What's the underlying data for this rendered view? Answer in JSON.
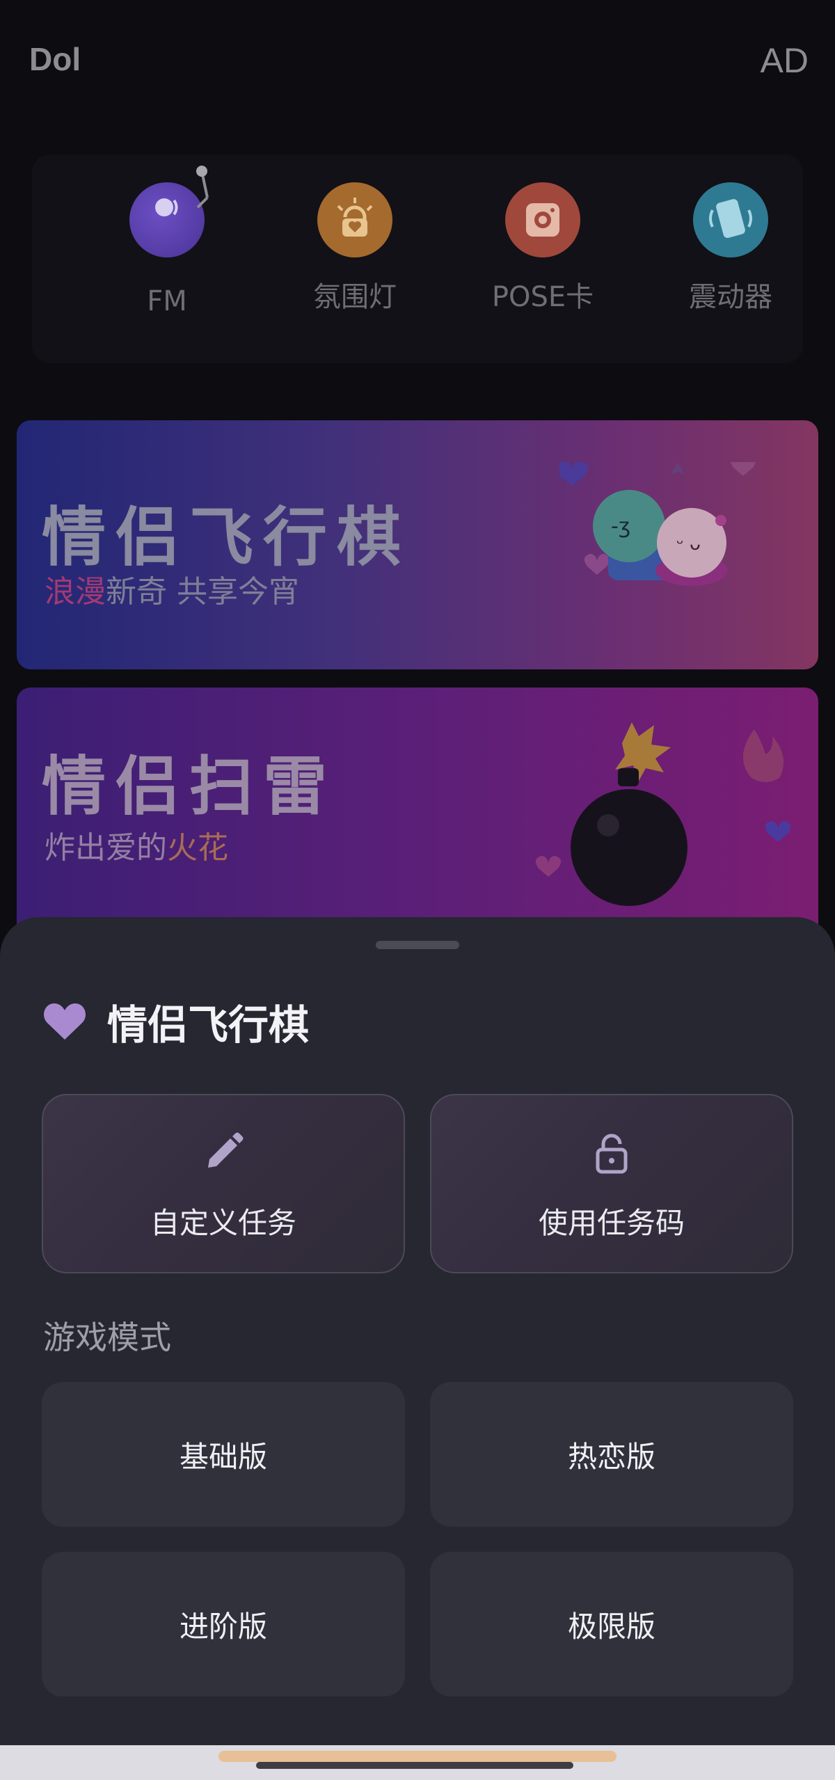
{
  "header": {
    "logo": "Dol",
    "ad_label": "AD"
  },
  "tools": [
    {
      "label": "FM",
      "icon": "radio-icon"
    },
    {
      "label": "氛围灯",
      "icon": "lamp-icon"
    },
    {
      "label": "POSE卡",
      "icon": "camera-icon"
    },
    {
      "label": "震动器",
      "icon": "vibrate-icon"
    }
  ],
  "banners": {
    "ludo": {
      "title": "情侣飞行棋",
      "subtitle_accent": "浪漫",
      "subtitle_rest": "新奇 共享今宵"
    },
    "minesweeper": {
      "title": "情侣扫雷",
      "subtitle_main": "炸出爱的",
      "subtitle_accent": "火花"
    }
  },
  "sheet": {
    "title": "情侣飞行棋",
    "actions": {
      "custom_task": "自定义任务",
      "use_task_code": "使用任务码"
    },
    "section_label": "游戏模式",
    "modes": {
      "basic": "基础版",
      "hot": "热恋版",
      "advanced": "进阶版",
      "extreme": "极限版"
    }
  },
  "colors": {
    "sheet_bg": "#262730",
    "accent_heart": "#a98ad0",
    "mode_button_bg": "#30313b"
  }
}
